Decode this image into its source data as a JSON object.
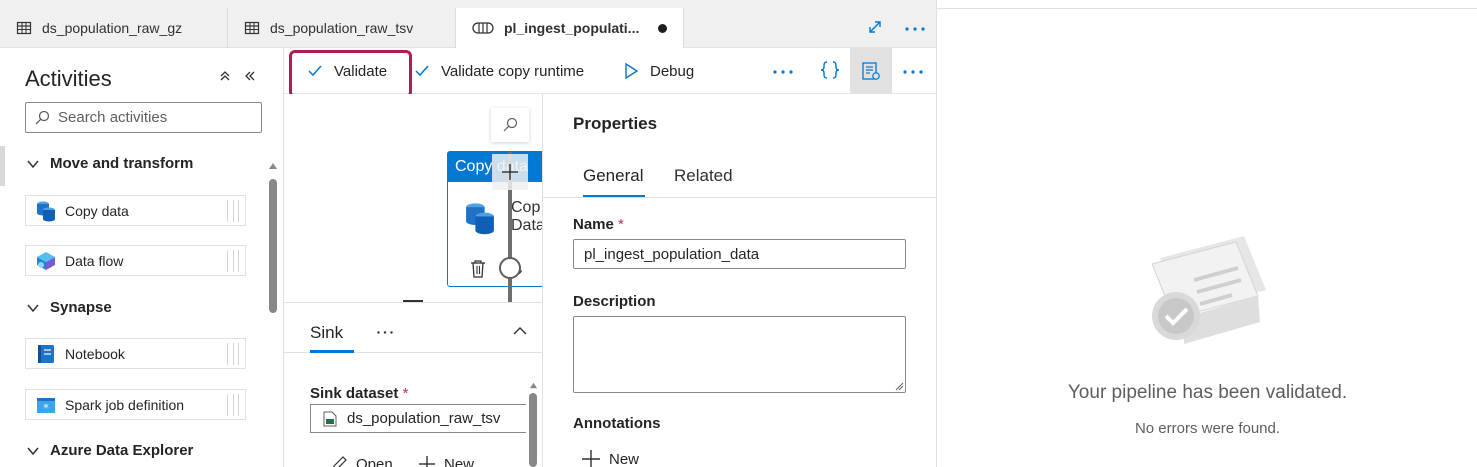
{
  "tabs": [
    {
      "label": "ds_population_raw_gz",
      "icon": "table-icon"
    },
    {
      "label": "ds_population_raw_tsv",
      "icon": "table-icon"
    },
    {
      "label": "pl_ingest_populati...",
      "icon": "pipeline-icon",
      "unsaved": true
    }
  ],
  "activities": {
    "title": "Activities",
    "search_placeholder": "Search activities",
    "categories": [
      {
        "label": "Move and transform",
        "items": [
          "Copy data",
          "Data flow"
        ]
      },
      {
        "label": "Synapse",
        "items": [
          "Notebook",
          "Spark job definition"
        ]
      },
      {
        "label": "Azure Data Explorer",
        "items": []
      }
    ]
  },
  "toolbar": {
    "validate": "Validate",
    "validate_copy_runtime": "Validate copy runtime",
    "debug": "Debug"
  },
  "canvas": {
    "activity_header": "Copy data",
    "activity_name_partial": "Cop",
    "activity_name_partial2": "Data"
  },
  "sink": {
    "tab_label": "Sink",
    "dataset_label": "Sink dataset",
    "dataset_value": "ds_population_raw_tsv",
    "open_label": "Open",
    "new_label": "New"
  },
  "properties": {
    "title": "Properties",
    "tabs": [
      "General",
      "Related"
    ],
    "name_label": "Name",
    "name_value": "pl_ingest_population_data",
    "description_label": "Description",
    "description_value": "",
    "annotations_label": "Annotations",
    "new_label": "New"
  },
  "validation": {
    "title": "Your pipeline has been validated.",
    "subtitle": "No errors were found."
  },
  "colors": {
    "accent": "#0078d4",
    "highlight": "#b5195b",
    "required": "#c4314b"
  }
}
